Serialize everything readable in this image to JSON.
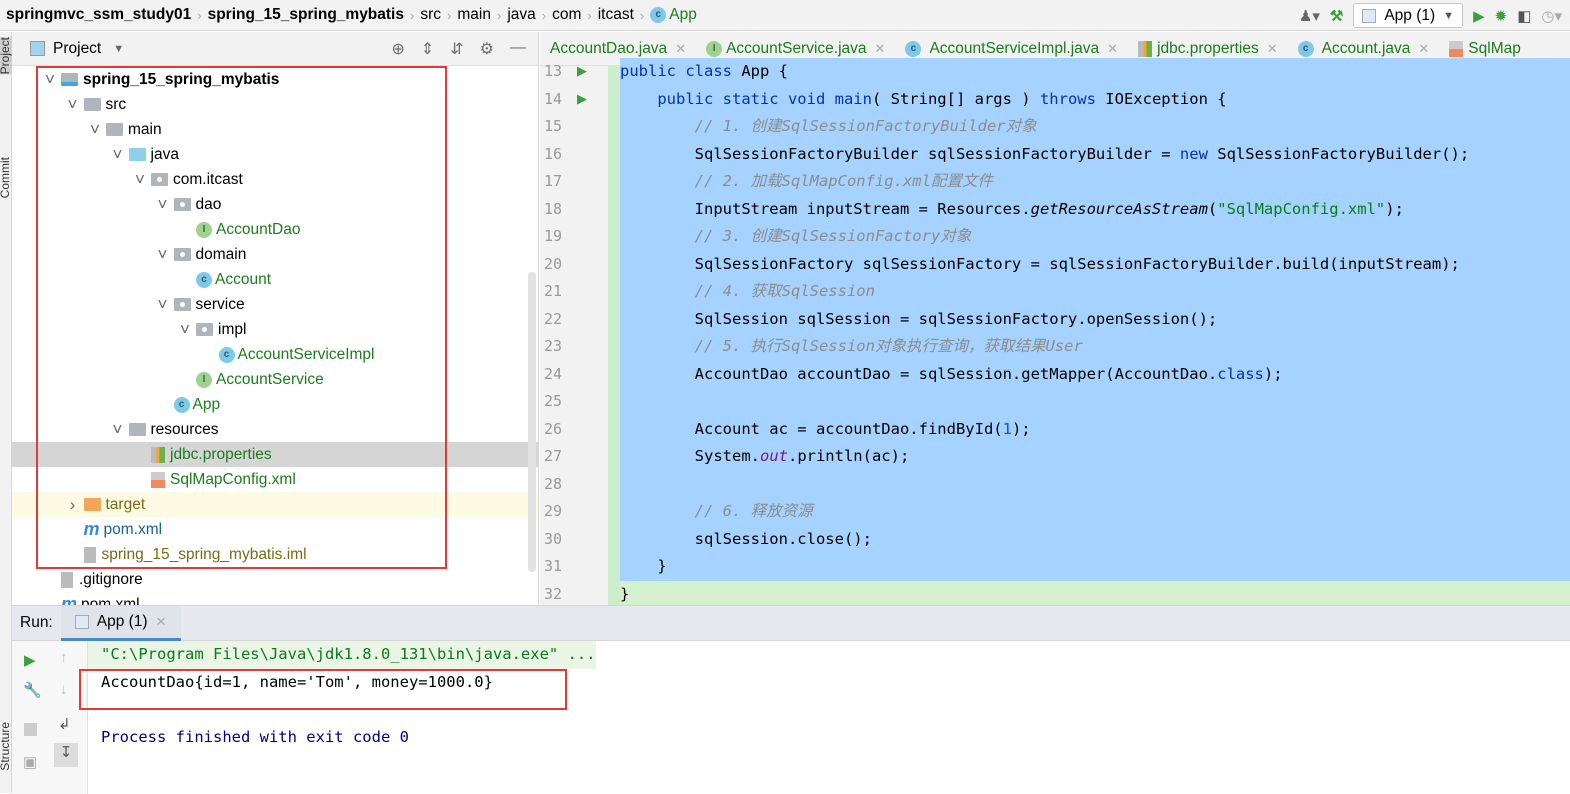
{
  "breadcrumb": [
    "springmvc_ssm_study01",
    "spring_15_spring_mybatis",
    "src",
    "main",
    "java",
    "com",
    "itcast",
    "App"
  ],
  "toolbar": {
    "run_config": "App (1)",
    "icons": [
      "user-icon",
      "hammer-icon",
      "run-icon",
      "debug-icon",
      "coverage-icon",
      "profile-icon"
    ]
  },
  "left_strip": {
    "project": "Project",
    "commit": "Commit",
    "structure": "Structure"
  },
  "project_panel": {
    "title": "Project",
    "icons": [
      "locate-icon",
      "expand-all-icon",
      "collapse-all-icon",
      "gear-icon",
      "minimize-icon"
    ]
  },
  "tree": [
    {
      "label": "spring_15_spring_mybatis",
      "level": 0,
      "type": "module",
      "expanded": true,
      "bold": true
    },
    {
      "label": "src",
      "level": 1,
      "type": "folder",
      "expanded": true
    },
    {
      "label": "main",
      "level": 2,
      "type": "folder",
      "expanded": true
    },
    {
      "label": "java",
      "level": 3,
      "type": "source-folder",
      "expanded": true
    },
    {
      "label": "com.itcast",
      "level": 4,
      "type": "package",
      "expanded": true
    },
    {
      "label": "dao",
      "level": 5,
      "type": "package",
      "expanded": true
    },
    {
      "label": "AccountDao",
      "level": 6,
      "type": "interface"
    },
    {
      "label": "domain",
      "level": 5,
      "type": "package",
      "expanded": true
    },
    {
      "label": "Account",
      "level": 6,
      "type": "class"
    },
    {
      "label": "service",
      "level": 5,
      "type": "package",
      "expanded": true
    },
    {
      "label": "impl",
      "level": 6,
      "type": "package",
      "expanded": true
    },
    {
      "label": "AccountServiceImpl",
      "level": 7,
      "type": "class"
    },
    {
      "label": "AccountService",
      "level": 6,
      "type": "interface"
    },
    {
      "label": "App",
      "level": 5,
      "type": "main-class"
    },
    {
      "label": "resources",
      "level": 3,
      "type": "resources",
      "expanded": true
    },
    {
      "label": "jdbc.properties",
      "level": 4,
      "type": "properties",
      "selected": true
    },
    {
      "label": "SqlMapConfig.xml",
      "level": 4,
      "type": "xml"
    },
    {
      "label": "target",
      "level": 1,
      "type": "excluded",
      "expanded": false
    },
    {
      "label": "pom.xml",
      "level": 1,
      "type": "maven"
    },
    {
      "label": "spring_15_spring_mybatis.iml",
      "level": 1,
      "type": "iml"
    },
    {
      "label": ".gitignore",
      "level": 0,
      "type": "file"
    },
    {
      "label": "pom.xml",
      "level": 0,
      "type": "maven"
    }
  ],
  "editor_tabs": [
    {
      "label": "AccountDao.java",
      "icon": "interface"
    },
    {
      "label": "AccountService.java",
      "icon": "interface"
    },
    {
      "label": "AccountServiceImpl.java",
      "icon": "class"
    },
    {
      "label": "jdbc.properties",
      "icon": "properties"
    },
    {
      "label": "Account.java",
      "icon": "class"
    },
    {
      "label": "SqlMap",
      "icon": "xml"
    }
  ],
  "code": [
    {
      "n": "13",
      "run": true,
      "t": [
        [
          "k",
          "public class "
        ],
        [
          "",
          "App {"
        ]
      ]
    },
    {
      "n": "14",
      "run": true,
      "t": [
        [
          "",
          "    "
        ],
        [
          "k",
          "public static void "
        ],
        [
          "k",
          "main"
        ],
        [
          "",
          "( String[] args ) "
        ],
        [
          "k",
          "throws "
        ],
        [
          "",
          "IOException {"
        ]
      ]
    },
    {
      "n": "15",
      "t": [
        [
          "",
          "        "
        ],
        [
          "cm",
          "// 1. 创建SqlSessionFactoryBuilder对象"
        ]
      ]
    },
    {
      "n": "16",
      "t": [
        [
          "",
          "        SqlSessionFactoryBuilder sqlSessionFactoryBuilder = "
        ],
        [
          "k",
          "new "
        ],
        [
          "",
          "SqlSessionFactoryBuilder();"
        ]
      ]
    },
    {
      "n": "17",
      "t": [
        [
          "",
          "        "
        ],
        [
          "cm",
          "// 2. 加载SqlMapConfig.xml配置文件"
        ]
      ]
    },
    {
      "n": "18",
      "t": [
        [
          "",
          "        InputStream inputStream = Resources."
        ],
        [
          "it",
          "getResourceAsStream"
        ],
        [
          "",
          "("
        ],
        [
          "s",
          "\"SqlMapConfig.xml\""
        ],
        [
          "",
          "); "
        ]
      ]
    },
    {
      "n": "19",
      "t": [
        [
          "",
          "        "
        ],
        [
          "cm",
          "// 3. 创建SqlSessionFactory对象"
        ]
      ]
    },
    {
      "n": "20",
      "t": [
        [
          "",
          "        SqlSessionFactory sqlSessionFactory = sqlSessionFactoryBuilder.build(inputStream);"
        ]
      ]
    },
    {
      "n": "21",
      "t": [
        [
          "",
          "        "
        ],
        [
          "cm",
          "// 4. 获取SqlSession"
        ]
      ]
    },
    {
      "n": "22",
      "t": [
        [
          "",
          "        SqlSession sqlSession = sqlSessionFactory.openSession();"
        ]
      ]
    },
    {
      "n": "23",
      "t": [
        [
          "",
          "        "
        ],
        [
          "cm",
          "// 5. 执行SqlSession对象执行查询，获取结果User"
        ]
      ]
    },
    {
      "n": "24",
      "t": [
        [
          "",
          "        AccountDao accountDao = sqlSession.getMapper(AccountDao."
        ],
        [
          "k",
          "class"
        ],
        [
          "",
          ");"
        ]
      ]
    },
    {
      "n": "25",
      "t": [
        [
          "",
          ""
        ]
      ]
    },
    {
      "n": "26",
      "t": [
        [
          "",
          "        Account ac = accountDao.findById("
        ],
        [
          "n",
          "1"
        ],
        [
          "",
          ");"
        ]
      ]
    },
    {
      "n": "27",
      "t": [
        [
          "",
          "        System."
        ],
        [
          "pu",
          "out"
        ],
        [
          "",
          ".println(ac);"
        ]
      ]
    },
    {
      "n": "28",
      "t": [
        [
          "",
          ""
        ]
      ]
    },
    {
      "n": "29",
      "t": [
        [
          "",
          "        "
        ],
        [
          "cm",
          "// 6. 释放资源"
        ]
      ]
    },
    {
      "n": "30",
      "t": [
        [
          "",
          "        sqlSession.close();"
        ]
      ]
    },
    {
      "n": "31",
      "t": [
        [
          "",
          "    }"
        ]
      ]
    },
    {
      "n": "32",
      "t": [
        [
          "",
          "}"
        ]
      ]
    }
  ],
  "run_panel": {
    "label": "Run:",
    "tab": "App (1)",
    "console": [
      "\"C:\\Program Files\\Java\\jdk1.8.0_131\\bin\\java.exe\" ...",
      "AccountDao{id=1, name='Tom', money=1000.0}",
      "",
      "Process finished with exit code 0"
    ]
  },
  "colors": {
    "highlight_box": "#e53935",
    "selection": "#a6d2ff",
    "keyword": "#0033b3",
    "string": "#067d17",
    "comment": "#8c8c8c"
  }
}
